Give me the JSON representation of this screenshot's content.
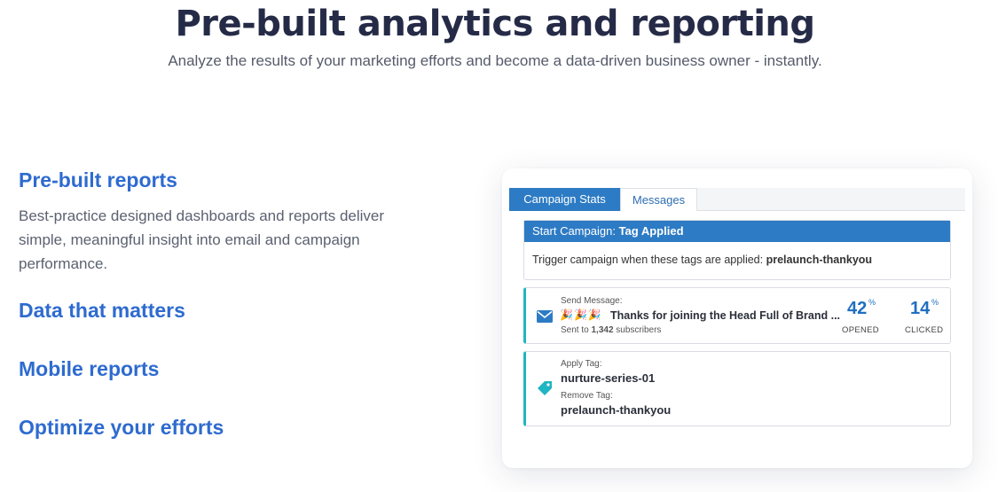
{
  "hero": {
    "title": "Pre-built analytics and reporting",
    "subtitle": "Analyze the results of your marketing efforts and become a data-driven business owner - instantly."
  },
  "features": {
    "items": [
      {
        "title": "Pre-built reports",
        "description": "Best-practice designed dashboards and reports deliver simple, meaningful insight into email and campaign performance."
      },
      {
        "title": "Data that matters"
      },
      {
        "title": "Mobile reports"
      },
      {
        "title": "Optimize your efforts"
      }
    ]
  },
  "panel": {
    "tabs": [
      {
        "label": "Campaign Stats",
        "active": true
      },
      {
        "label": "Messages",
        "active": false
      }
    ],
    "start": {
      "label": "Start Campaign:",
      "value": "Tag Applied",
      "body_text": "Trigger campaign when these tags are applied:",
      "body_tag": "prelaunch-thankyou"
    },
    "message": {
      "icon": "envelope-icon",
      "label": "Send Message:",
      "emoji": "🎉🎉🎉",
      "subject": "Thanks for joining the Head Full of Brand ...",
      "sent_prefix": "Sent to",
      "sent_count": "1,342",
      "sent_suffix": "subscribers",
      "opened_value": "42",
      "opened_unit": "%",
      "opened_label": "OPENED",
      "clicked_value": "14",
      "clicked_unit": "%",
      "clicked_label": "CLICKED"
    },
    "tag_step": {
      "icon": "tag-icon",
      "apply_label": "Apply Tag:",
      "apply_value": "nurture-series-01",
      "remove_label": "Remove Tag:",
      "remove_value": "prelaunch-thankyou"
    }
  },
  "colors": {
    "heading": "#252b47",
    "feature": "#2e6bcf",
    "accent_blue": "#2d7bc4",
    "teal": "#1fb5c2"
  }
}
